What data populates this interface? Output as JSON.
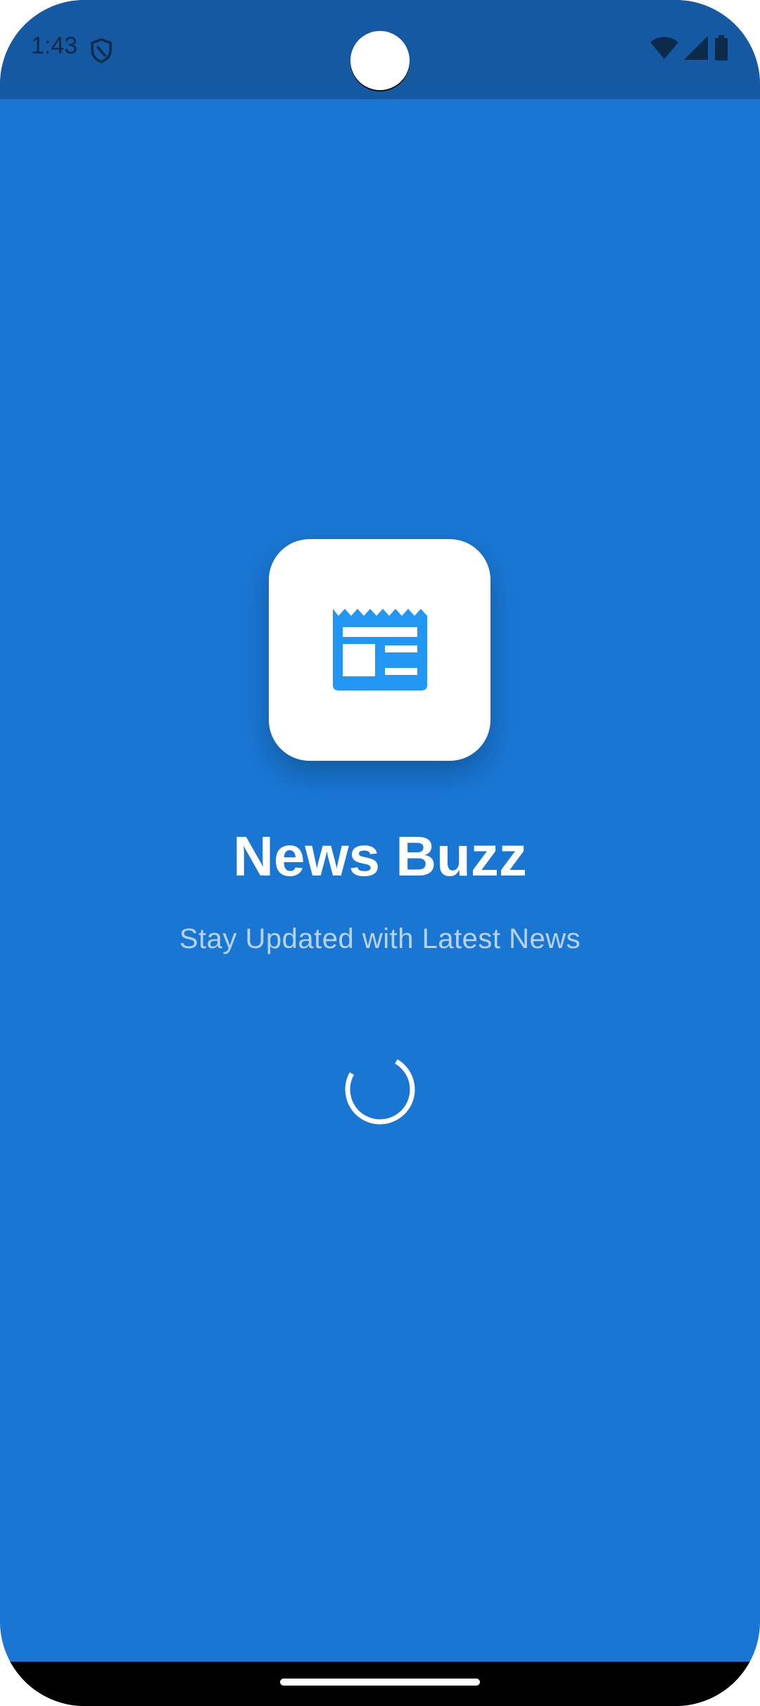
{
  "status_bar": {
    "time": "1:43",
    "icons": [
      "shield-icon",
      "wifi-icon",
      "cellular-signal-icon",
      "battery-icon"
    ]
  },
  "splash": {
    "logo_icon": "newspaper-icon",
    "title": "News Buzz",
    "subtitle": "Stay Updated with Latest News",
    "loading_indicator": "circular-progress"
  },
  "colors": {
    "background": "#1976d2",
    "status_bar": "#1559a2",
    "logo_card": "#ffffff",
    "logo_icon": "#2196f3",
    "title": "#ffffff",
    "subtitle": "#b9d3f1",
    "nav_bar": "#000000"
  }
}
